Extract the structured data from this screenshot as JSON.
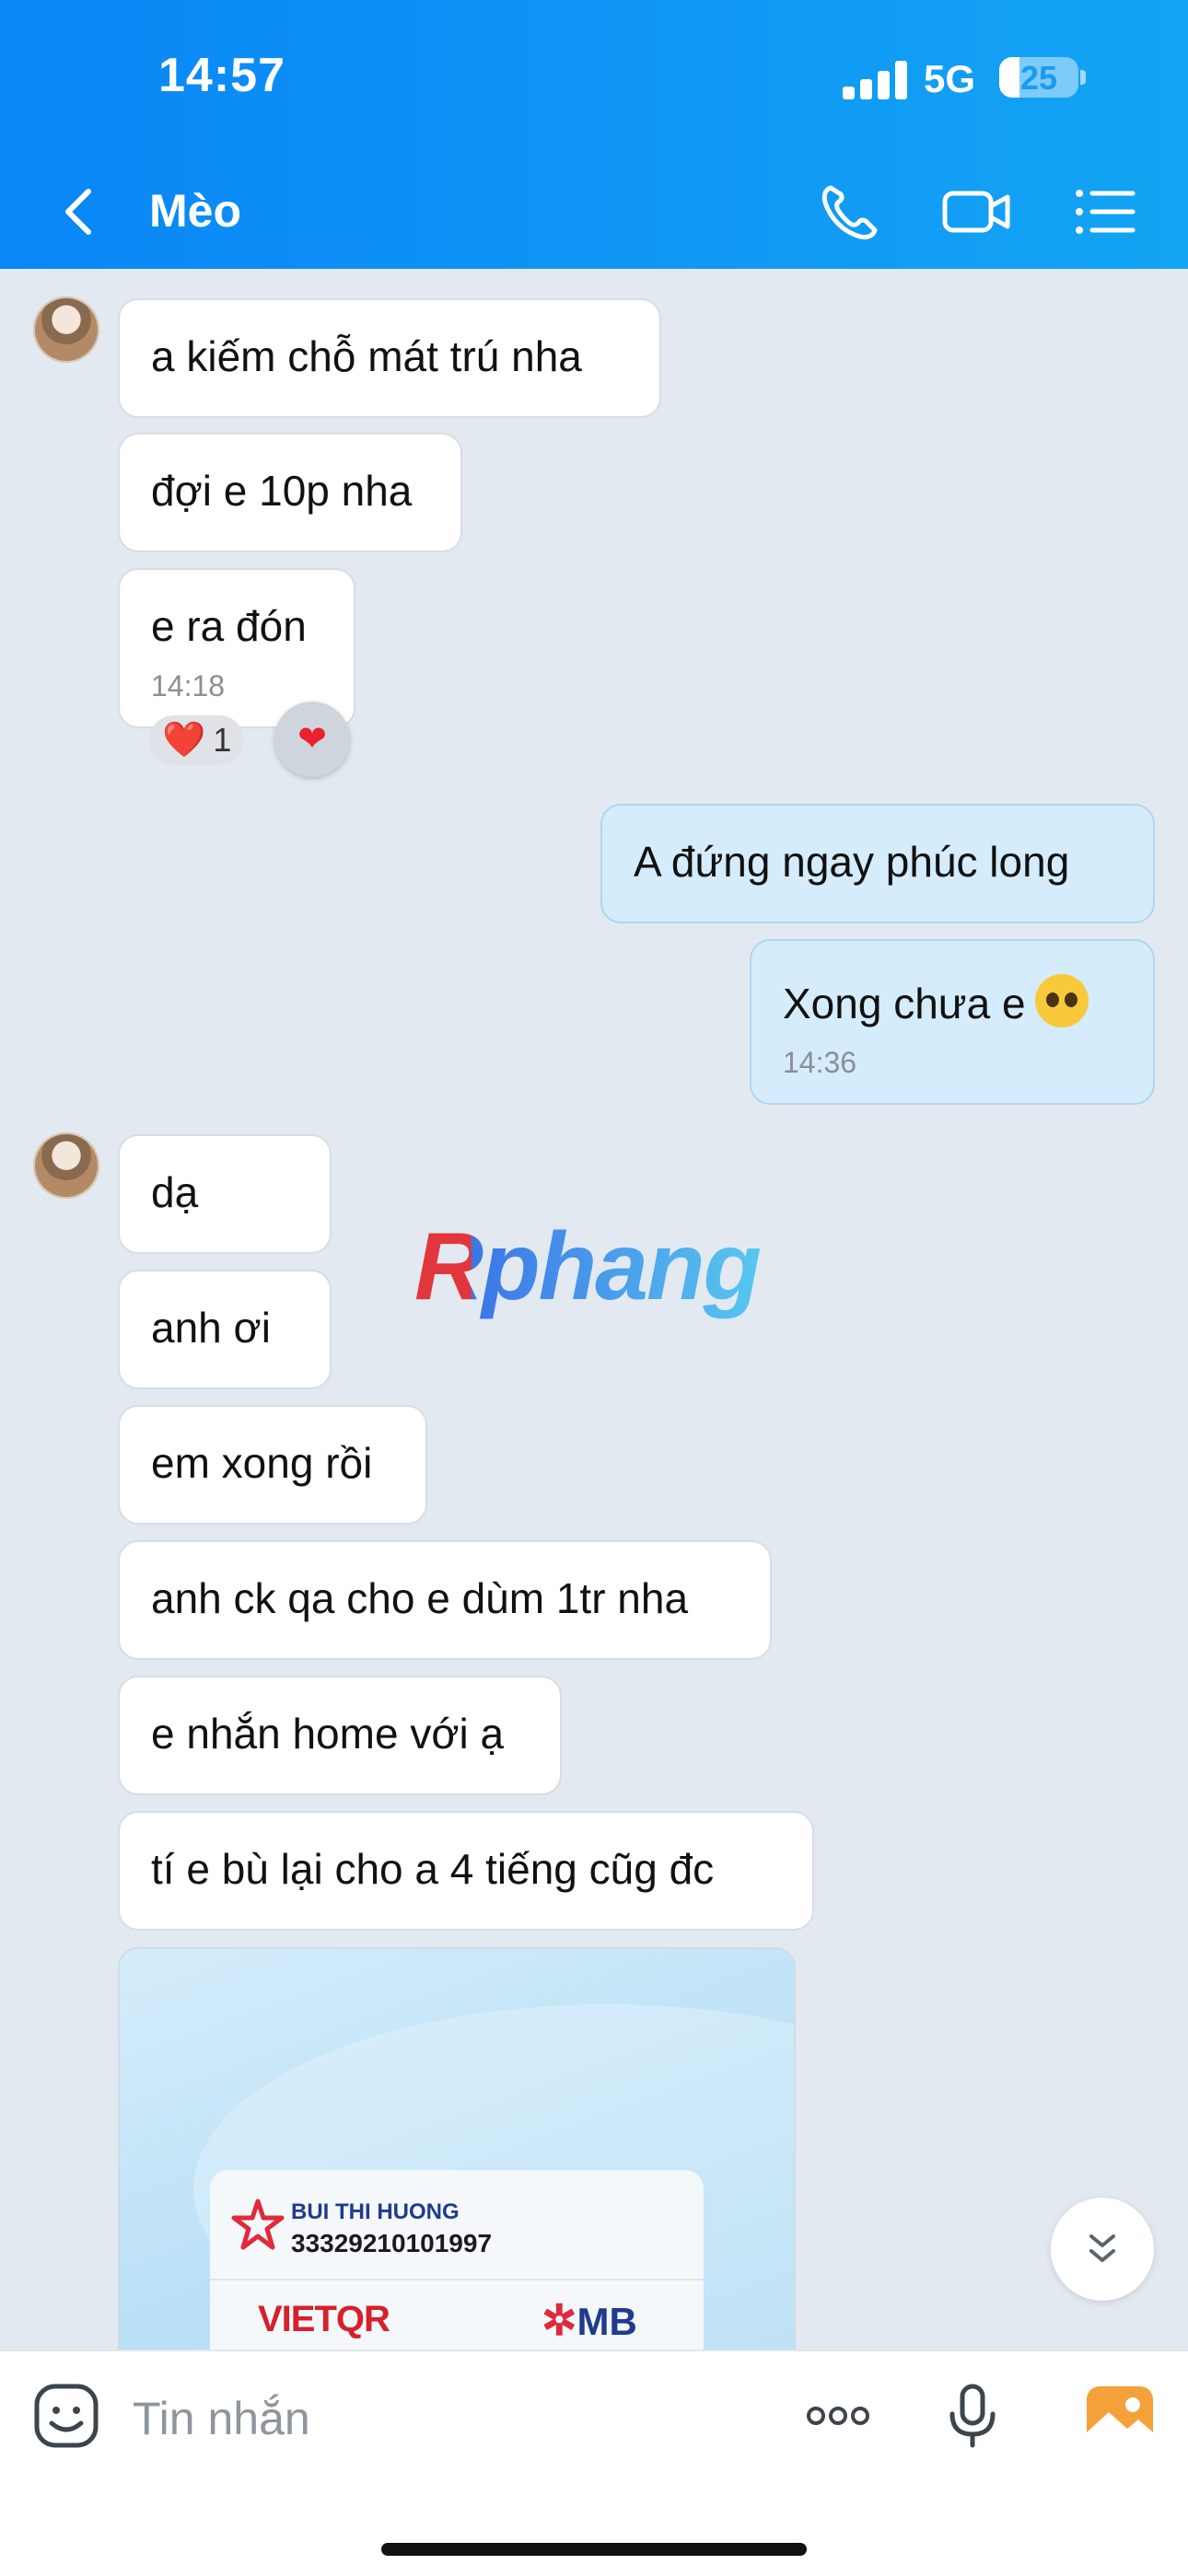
{
  "status_bar": {
    "time": "14:57",
    "network": "5G",
    "battery": "25",
    "battery_level": 0.25
  },
  "header": {
    "title": "Mèo",
    "icons": [
      "back-icon",
      "phone-icon",
      "video-call-icon",
      "menu-list-icon"
    ],
    "color": "#0a86f7"
  },
  "messages": [
    {
      "sender": "other",
      "text": "a kiếm chỗ mát trú nha"
    },
    {
      "sender": "other",
      "text": "đợi e 10p nha"
    },
    {
      "sender": "other",
      "text": "e ra đón",
      "time": "14:18",
      "reaction": "❤️",
      "reaction_count": "1"
    },
    {
      "sender": "me",
      "text": "A đứng ngay phúc long"
    },
    {
      "sender": "me",
      "text": "Xong chưa e",
      "emoji": "pleading-face",
      "time": "14:36"
    },
    {
      "sender": "other",
      "text": "dạ"
    },
    {
      "sender": "other",
      "text": "anh ơi"
    },
    {
      "sender": "other",
      "text": "em xong rồi"
    },
    {
      "sender": "other",
      "text": "anh ck qa cho e dùm 1tr nha"
    },
    {
      "sender": "other",
      "text": "e nhắn home với ạ"
    },
    {
      "sender": "other",
      "text": "tí e bù lại cho a 4 tiếng cũg đc"
    }
  ],
  "qr_image": {
    "account_name": "BUI THI HUONG",
    "account_number": "33329210101997",
    "brand_left": "VIETQR",
    "brand_right": "MB"
  },
  "watermark": "Rphang",
  "composer": {
    "placeholder": "Tin nhắn",
    "icons": [
      "sticker-icon",
      "more-icon",
      "microphone-icon",
      "image-icon"
    ]
  }
}
